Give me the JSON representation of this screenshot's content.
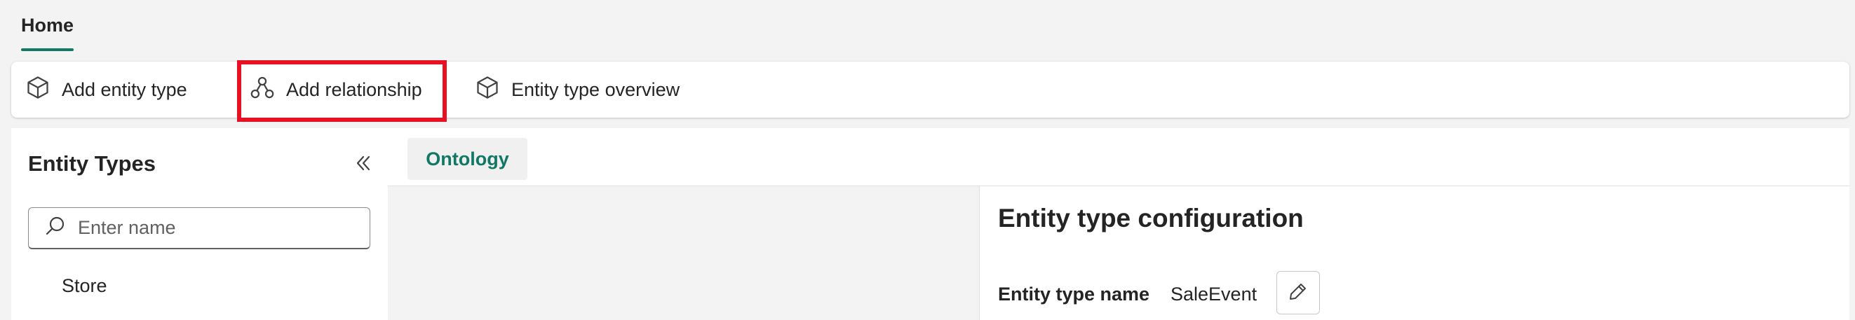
{
  "nav": {
    "home_tab": "Home"
  },
  "toolbar": {
    "add_entity_type": "Add entity type",
    "add_relationship": "Add relationship",
    "entity_type_overview": "Entity type overview"
  },
  "sidebar": {
    "title": "Entity Types",
    "search_placeholder": "Enter name",
    "items": [
      {
        "label": "Store"
      }
    ]
  },
  "main": {
    "tabs": [
      {
        "label": "Ontology"
      }
    ],
    "config": {
      "title": "Entity type configuration",
      "name_label": "Entity type name",
      "name_value": "SaleEvent"
    }
  },
  "colors": {
    "accent": "#117865",
    "highlight": "#e81123",
    "background": "#f3f3f3"
  }
}
